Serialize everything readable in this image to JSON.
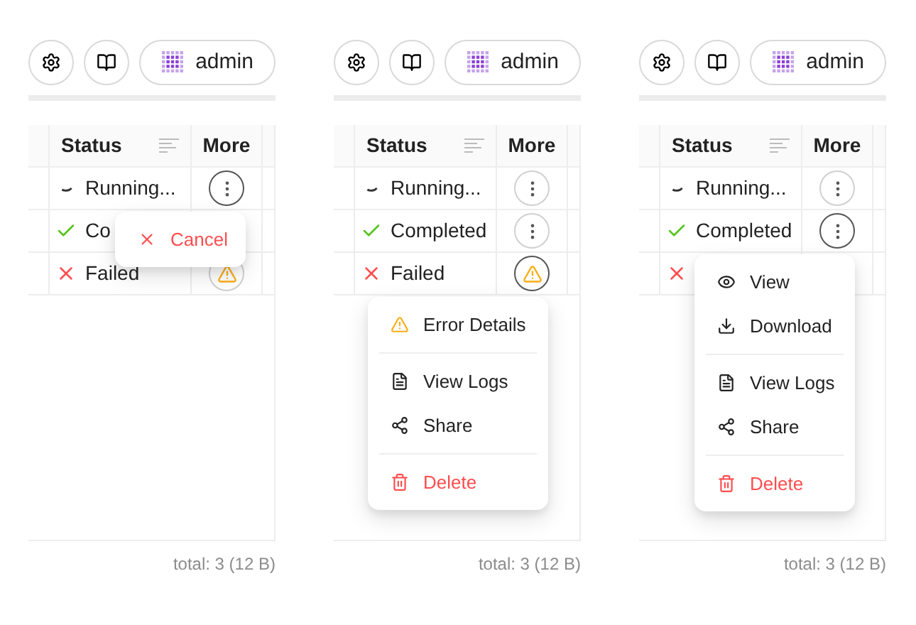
{
  "panels": [
    {
      "user": "admin",
      "columns": [
        "Status",
        "More"
      ],
      "rows": [
        {
          "kind": "running",
          "label": "Running...",
          "active": true
        },
        {
          "kind": "completed",
          "label": "Co"
        },
        {
          "kind": "failed",
          "label": "Failed",
          "active": false
        }
      ],
      "menu": [
        {
          "kind": "cancel",
          "label": "Cancel"
        }
      ],
      "footer": "total: 3 (12 B)"
    },
    {
      "user": "admin",
      "columns": [
        "Status",
        "More"
      ],
      "rows": [
        {
          "kind": "running",
          "label": "Running...",
          "active": false
        },
        {
          "kind": "completed",
          "label": "Completed",
          "active": false
        },
        {
          "kind": "failed",
          "label": "Failed",
          "active": true
        }
      ],
      "menu": [
        {
          "kind": "error",
          "label": "Error Details"
        },
        {
          "kind": "divider"
        },
        {
          "kind": "logs",
          "label": "View Logs"
        },
        {
          "kind": "share",
          "label": "Share"
        },
        {
          "kind": "divider"
        },
        {
          "kind": "delete",
          "label": "Delete"
        }
      ],
      "footer": "total: 3 (12 B)"
    },
    {
      "user": "admin",
      "columns": [
        "Status",
        "More"
      ],
      "rows": [
        {
          "kind": "running",
          "label": "Running...",
          "active": false
        },
        {
          "kind": "completed",
          "label": "Completed",
          "active": true
        },
        {
          "kind": "failed"
        }
      ],
      "menu": [
        {
          "kind": "view",
          "label": "View"
        },
        {
          "kind": "download",
          "label": "Download"
        },
        {
          "kind": "divider"
        },
        {
          "kind": "logs",
          "label": "View Logs"
        },
        {
          "kind": "share",
          "label": "Share"
        },
        {
          "kind": "divider"
        },
        {
          "kind": "delete",
          "label": "Delete"
        }
      ],
      "footer": "total: 3 (12 B)"
    }
  ]
}
